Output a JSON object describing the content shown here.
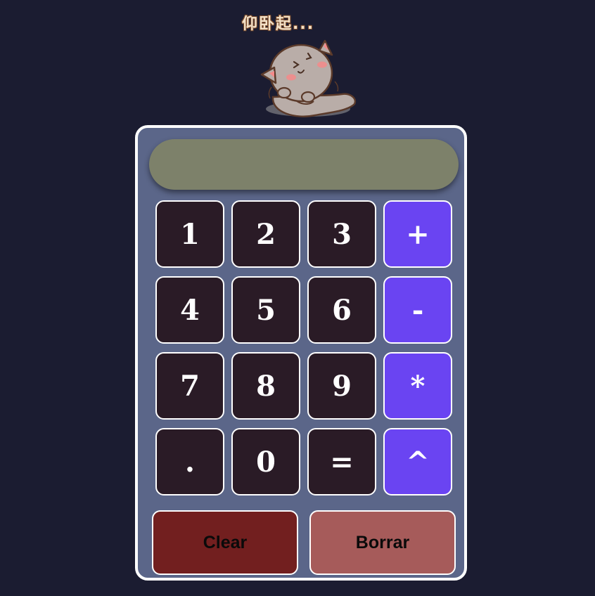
{
  "sticker": {
    "caption": "仰卧起...",
    "image_icon": "cat-doing-situps-icon"
  },
  "display": {
    "value": ""
  },
  "keypad": {
    "rows": [
      [
        {
          "label": "1",
          "kind": "digit"
        },
        {
          "label": "2",
          "kind": "digit"
        },
        {
          "label": "3",
          "kind": "digit"
        },
        {
          "label": "+",
          "kind": "op"
        }
      ],
      [
        {
          "label": "4",
          "kind": "digit"
        },
        {
          "label": "5",
          "kind": "digit"
        },
        {
          "label": "6",
          "kind": "digit"
        },
        {
          "label": "-",
          "kind": "op"
        }
      ],
      [
        {
          "label": "7",
          "kind": "digit"
        },
        {
          "label": "8",
          "kind": "digit"
        },
        {
          "label": "9",
          "kind": "digit"
        },
        {
          "label": "*",
          "kind": "op"
        }
      ],
      [
        {
          "label": ".",
          "kind": "digit"
        },
        {
          "label": "0",
          "kind": "digit"
        },
        {
          "label": "=",
          "kind": "digit"
        },
        {
          "label": "^",
          "kind": "op"
        }
      ]
    ]
  },
  "actions": {
    "clear_label": "Clear",
    "borrar_label": "Borrar"
  },
  "colors": {
    "page_background": "#1b1c31",
    "calculator_body": "#5b6689",
    "display_background": "#7d816a",
    "digit_key": "#2a1b26",
    "operator_key": "#6a44f2",
    "clear_button": "#721f1f",
    "borrar_button": "#a65b5a"
  }
}
